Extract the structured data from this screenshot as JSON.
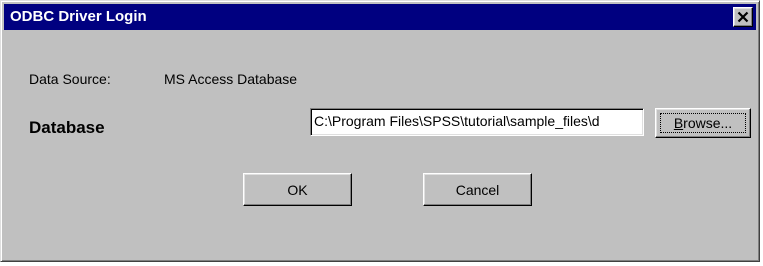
{
  "window": {
    "title": "ODBC Driver Login",
    "close_glyph": "×",
    "title_bar_color": "#000080",
    "face_color": "#c0c0c0"
  },
  "form": {
    "data_source_label": "Data Source:",
    "data_source_value": "MS Access Database",
    "database_label": "Database",
    "database_value": "C:\\Program Files\\SPSS\\tutorial\\sample_files\\d"
  },
  "buttons": {
    "browse_accel": "B",
    "browse_rest": "rowse...",
    "ok": "OK",
    "cancel": "Cancel"
  },
  "icons": {
    "close": "close-icon"
  }
}
